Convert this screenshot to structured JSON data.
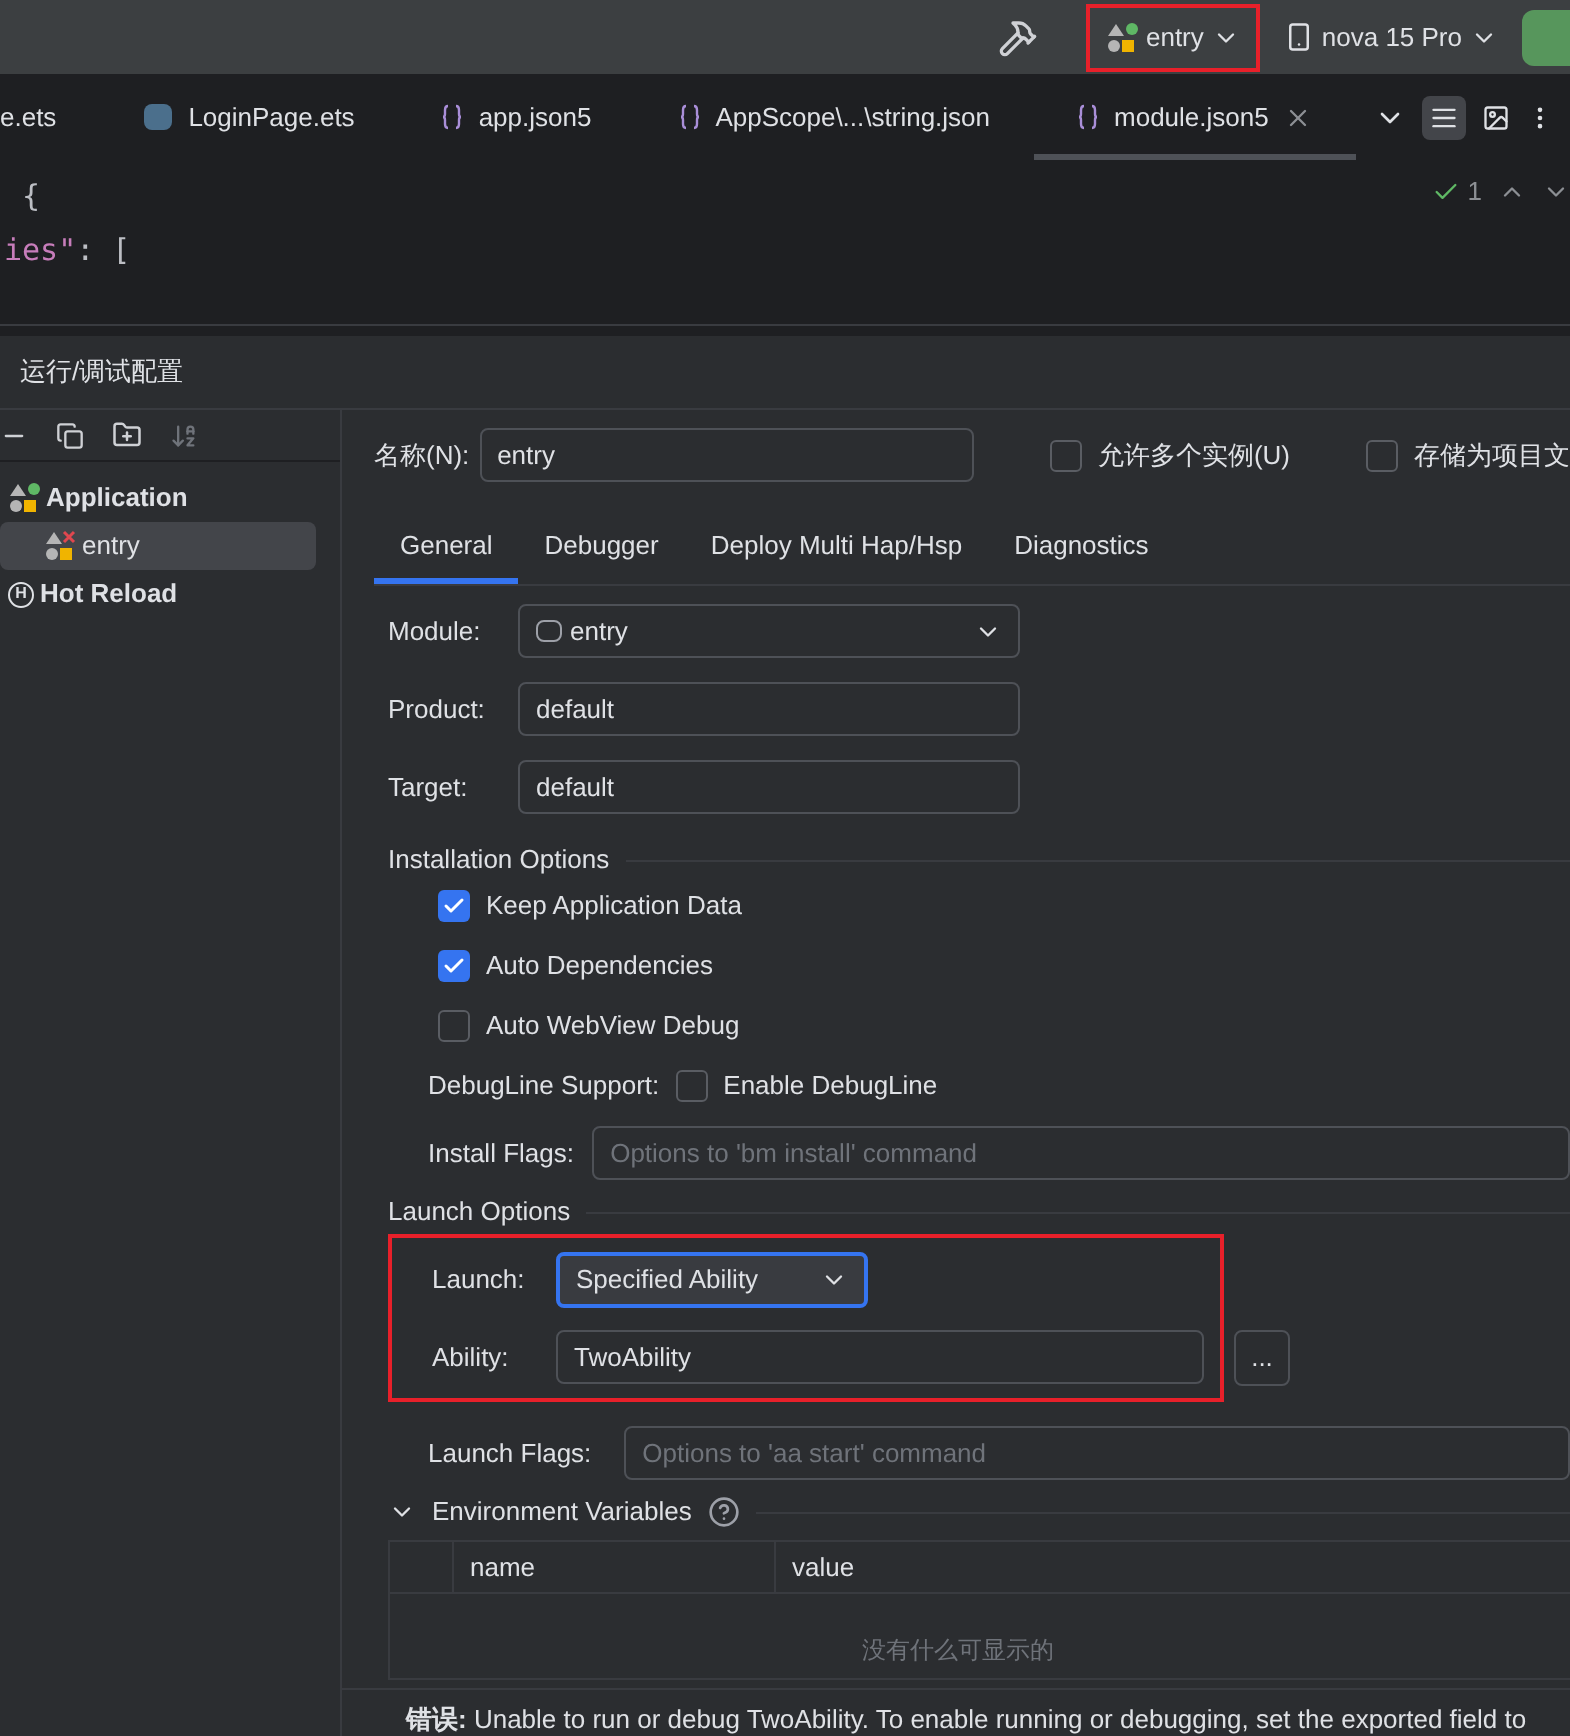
{
  "toolbar": {
    "run_config": {
      "label": "entry",
      "highlighted": true
    },
    "device": {
      "label": "nova 15 Pro"
    }
  },
  "editor_tabs": [
    {
      "label": "e.ets",
      "selected": false
    },
    {
      "label": "LoginPage.ets",
      "kind": "ets",
      "selected": false
    },
    {
      "label": "app.json5",
      "kind": "json",
      "selected": false
    },
    {
      "label": "AppScope\\...\\string.json",
      "kind": "json",
      "selected": false
    },
    {
      "label": "module.json5",
      "kind": "json",
      "selected": true
    }
  ],
  "editor": {
    "lines": [
      {
        "punct": "{"
      },
      {
        "key": "ies\"",
        "punct": ": ["
      }
    ],
    "inspection_count": "1"
  },
  "dialog": {
    "title": "运行/调试配置",
    "tree": [
      {
        "label": "Application",
        "kind": "app",
        "selected": false,
        "children": [
          {
            "label": "entry",
            "kind": "entry",
            "selected": true
          }
        ]
      },
      {
        "label": "Hot Reload",
        "kind": "hot",
        "badge": "H",
        "selected": false
      }
    ],
    "name_label": "名称(N):",
    "name_value": "entry",
    "options": [
      {
        "label": "允许多个实例(U)",
        "checked": false
      },
      {
        "label": "存储为项目文",
        "checked": false
      }
    ],
    "tabs": [
      {
        "label": "General",
        "selected": true
      },
      {
        "label": "Debugger",
        "selected": false
      },
      {
        "label": "Deploy Multi Hap/Hsp",
        "selected": false
      },
      {
        "label": "Diagnostics",
        "selected": false
      }
    ],
    "module": {
      "label": "Module:",
      "value": "entry"
    },
    "product": {
      "label": "Product:",
      "value": "default"
    },
    "target": {
      "label": "Target:",
      "value": "default"
    },
    "installation": {
      "title": "Installation Options",
      "checks": [
        {
          "label": "Keep Application Data",
          "checked": true
        },
        {
          "label": "Auto Dependencies",
          "checked": true
        },
        {
          "label": "Auto WebView Debug",
          "checked": false
        }
      ],
      "debugline_label": "DebugLine Support:",
      "debugline": {
        "label": "Enable DebugLine",
        "checked": false
      },
      "flags_label": "Install Flags:",
      "flags_placeholder": "Options to 'bm install' command"
    },
    "launch": {
      "title": "Launch Options",
      "highlighted": true,
      "launch_label": "Launch:",
      "launch_value": "Specified Ability",
      "ability_label": "Ability:",
      "ability_value": "TwoAbility",
      "browse": "...",
      "flags_label": "Launch Flags:",
      "flags_placeholder": "Options to 'aa start' command"
    },
    "env": {
      "title": "Environment Variables",
      "expanded": true,
      "columns": [
        "name",
        "value"
      ],
      "empty": "没有什么可显示的"
    },
    "error": "**错误:** Unable to run or debug TwoAbility. To enable running or debugging, set the exported field to"
  }
}
